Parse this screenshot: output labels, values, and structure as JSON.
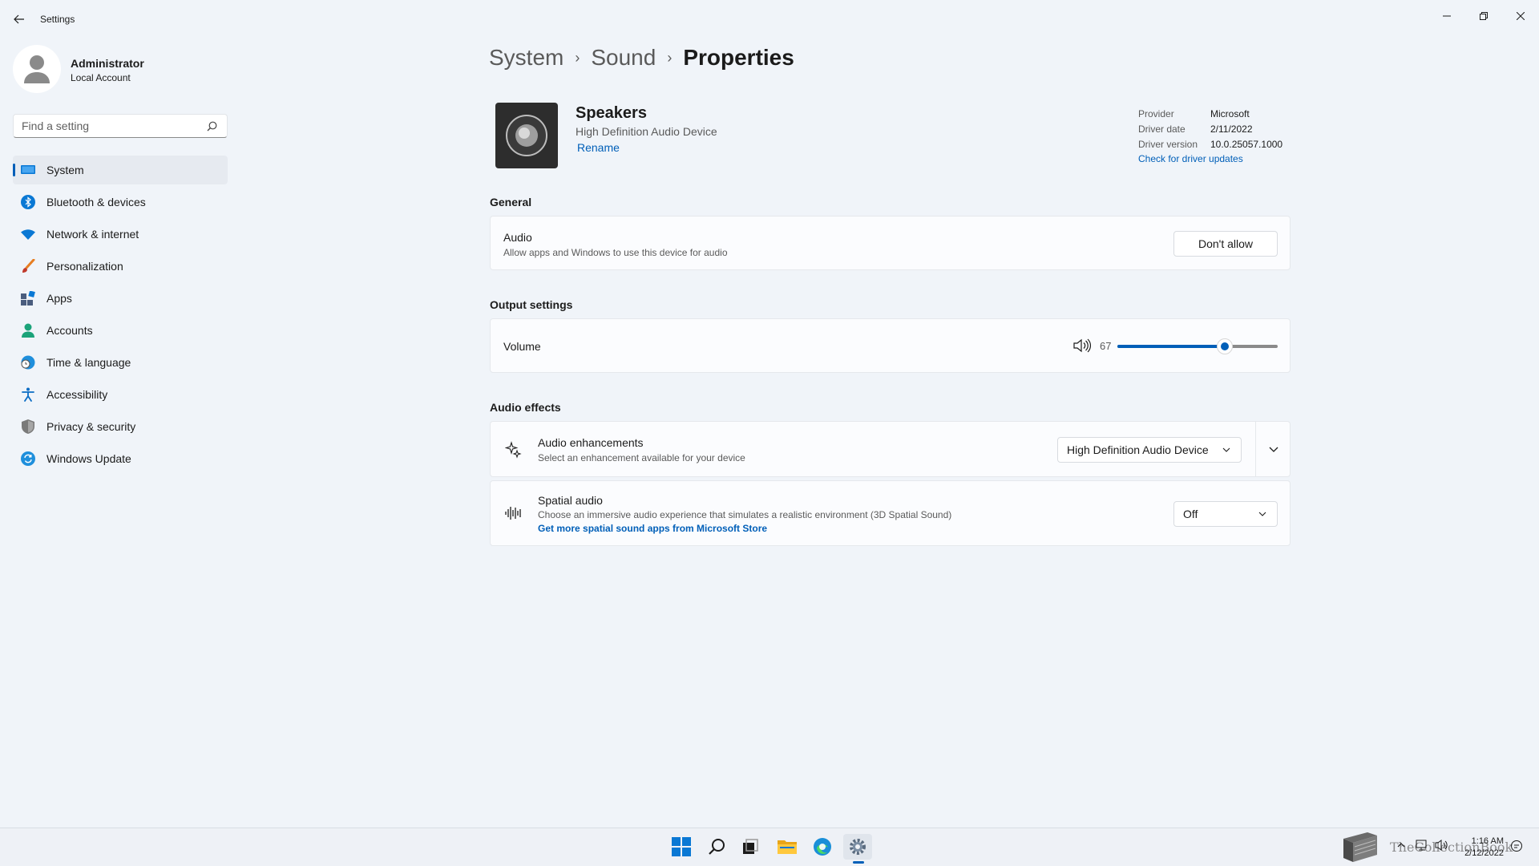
{
  "window": {
    "title": "Settings"
  },
  "profile": {
    "name": "Administrator",
    "account_type": "Local Account"
  },
  "search": {
    "placeholder": "Find a setting"
  },
  "sidebar": {
    "items": [
      {
        "label": "System",
        "icon": "system-icon",
        "active": true
      },
      {
        "label": "Bluetooth & devices",
        "icon": "bluetooth-icon"
      },
      {
        "label": "Network & internet",
        "icon": "wifi-icon"
      },
      {
        "label": "Personalization",
        "icon": "brush-icon"
      },
      {
        "label": "Apps",
        "icon": "apps-icon"
      },
      {
        "label": "Accounts",
        "icon": "person-icon"
      },
      {
        "label": "Time & language",
        "icon": "globe-clock-icon"
      },
      {
        "label": "Accessibility",
        "icon": "accessibility-icon"
      },
      {
        "label": "Privacy & security",
        "icon": "shield-icon"
      },
      {
        "label": "Windows Update",
        "icon": "update-icon"
      }
    ]
  },
  "breadcrumb": {
    "items": [
      "System",
      "Sound",
      "Properties"
    ]
  },
  "device": {
    "name": "Speakers",
    "subtitle": "High Definition Audio Device",
    "rename_label": "Rename"
  },
  "driver": {
    "provider_label": "Provider",
    "provider": "Microsoft",
    "date_label": "Driver date",
    "date": "2/11/2022",
    "version_label": "Driver version",
    "version": "10.0.25057.1000",
    "update_link": "Check for driver updates"
  },
  "general": {
    "section_title": "General",
    "audio_title": "Audio",
    "audio_desc": "Allow apps and Windows to use this device for audio",
    "audio_button": "Don't allow"
  },
  "output": {
    "section_title": "Output settings",
    "volume_label": "Volume",
    "volume_value": "67",
    "volume_fraction": 0.67
  },
  "effects": {
    "section_title": "Audio effects",
    "enhancements_title": "Audio enhancements",
    "enhancements_desc": "Select an enhancement available for your device",
    "enhancements_value": "High Definition Audio Device",
    "spatial_title": "Spatial audio",
    "spatial_desc": "Choose an immersive audio experience that simulates a realistic environment (3D Spatial Sound)",
    "spatial_link": "Get more spatial sound apps from Microsoft Store",
    "spatial_value": "Off"
  },
  "taskbar": {
    "time": "1:16 AM",
    "date": "2/12/2022",
    "watermark": "TheCollectionBook"
  },
  "colors": {
    "accent": "#005fb8",
    "background": "#f0f4f9"
  }
}
